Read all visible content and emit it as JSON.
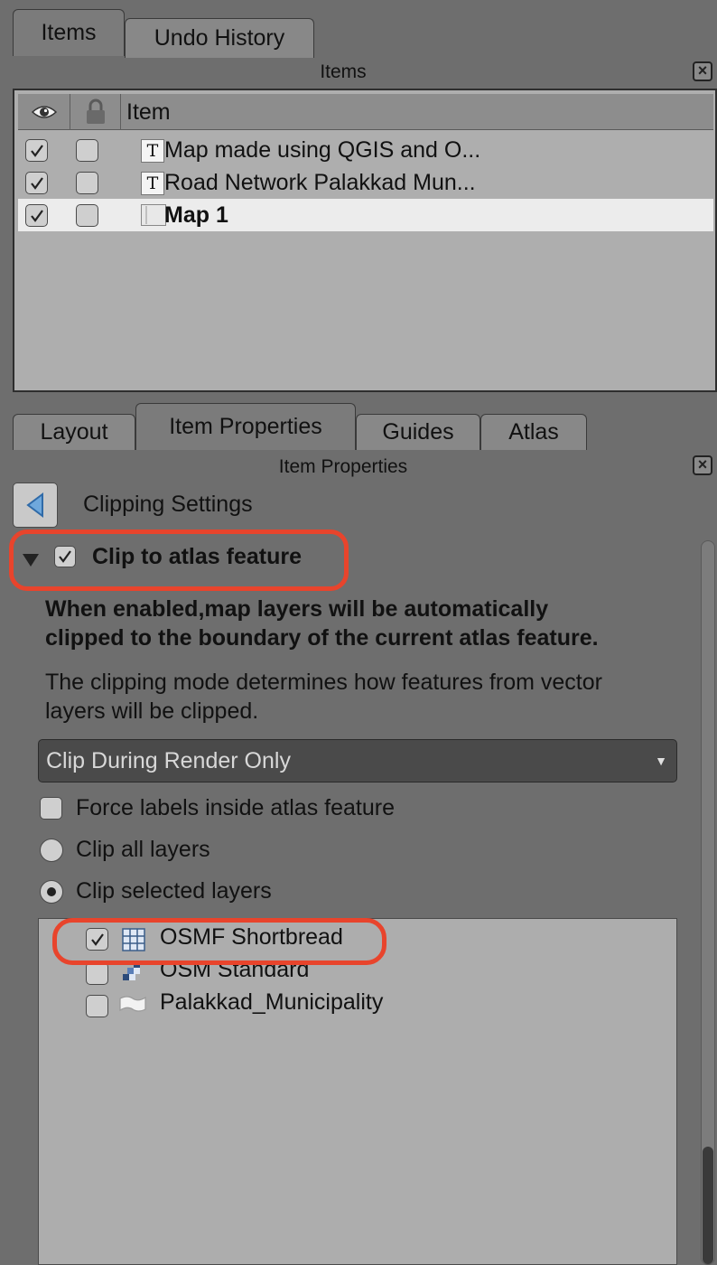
{
  "top_tabs": [
    "Items",
    "Undo History"
  ],
  "items_panel": {
    "title": "Items",
    "header": {
      "visibility_icon": "eye-icon",
      "lock_icon": "lock-icon",
      "item_label": "Item"
    },
    "rows": [
      {
        "visible": true,
        "locked": false,
        "icon": "text-item-icon",
        "label": "Map made using QGIS and O...",
        "selected": false
      },
      {
        "visible": true,
        "locked": false,
        "icon": "text-item-icon",
        "label": "Road Network Palakkad Mun...",
        "selected": false
      },
      {
        "visible": true,
        "locked": false,
        "icon": "map-item-icon",
        "label": "Map 1",
        "selected": true
      }
    ]
  },
  "bottom_tabs": [
    "Layout",
    "Item Properties",
    "Guides",
    "Atlas"
  ],
  "properties": {
    "title": "Item Properties",
    "section_title": "Clipping Settings",
    "clip_to_atlas": {
      "label": "Clip to atlas feature",
      "checked": true
    },
    "description_bold": "When enabled,map layers will be automatically clipped to the boundary of the current atlas feature.",
    "description_bold_line1": "When enabled,map layers will be automatically",
    "description_bold_line2": "clipped to the boundary of the current atlas feature.",
    "description_line1": "The clipping mode determines how features from vector",
    "description_line2": "layers will be clipped.",
    "clip_mode": {
      "selected": "Clip During Render Only"
    },
    "force_labels": {
      "label": "Force labels inside atlas feature",
      "checked": false
    },
    "clip_all_layers": {
      "label": "Clip all layers",
      "selected": false
    },
    "clip_selected_layers": {
      "label": "Clip selected layers",
      "selected": true
    },
    "layers": [
      {
        "label": "OSMF Shortbread",
        "checked": true,
        "icon": "vector-tile-icon"
      },
      {
        "label": "OSM Standard",
        "checked": false,
        "icon": "raster-icon"
      },
      {
        "label": "Palakkad_Municipality",
        "checked": false,
        "icon": "polygon-icon"
      }
    ]
  },
  "colors": {
    "highlight": "#e8442c",
    "background": "#6e6e6e",
    "selected_row": "#ececec"
  }
}
